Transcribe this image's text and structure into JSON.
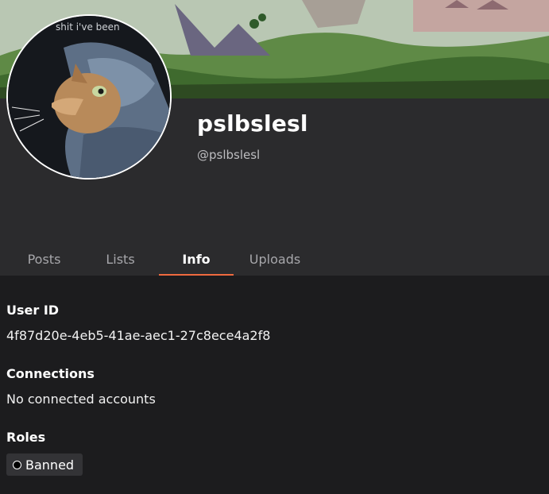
{
  "profile": {
    "display_name": "pslbslesl",
    "handle": "@pslbslesl",
    "avatar_caption": "shit i've been"
  },
  "tabs": [
    {
      "label": "Posts",
      "active": false
    },
    {
      "label": "Lists",
      "active": false
    },
    {
      "label": "Info",
      "active": true
    },
    {
      "label": "Uploads",
      "active": false
    }
  ],
  "info": {
    "user_id_label": "User ID",
    "user_id_value": "4f87d20e-4eb5-41ae-aec1-27c8ece4a2f8",
    "connections_label": "Connections",
    "connections_value": "No connected accounts",
    "roles_label": "Roles",
    "roles": [
      "Banned"
    ]
  },
  "colors": {
    "background": "#1c1c1e",
    "header_panel": "#2b2b2d",
    "accent": "#ef6a3f",
    "tab_inactive": "#a7a7ab",
    "chip_background": "#333336"
  }
}
